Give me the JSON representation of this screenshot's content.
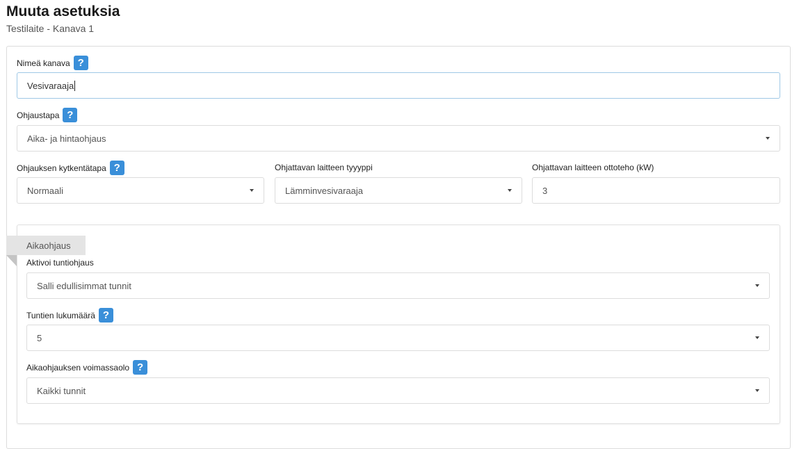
{
  "header": {
    "title": "Muuta asetuksia",
    "subtitle": "Testilaite - Kanava 1"
  },
  "help_glyph": "?",
  "fields": {
    "channel_name": {
      "label": "Nimeä kanava",
      "value": "Vesivaraaja"
    },
    "control_method": {
      "label": "Ohjaustapa",
      "value": "Aika- ja hintaohjaus"
    },
    "switching_mode": {
      "label": "Ohjauksen kytkentätapa",
      "value": "Normaali"
    },
    "device_type": {
      "label": "Ohjattavan laitteen tyyyppi",
      "value": "Lämminvesivaraaja"
    },
    "device_power": {
      "label": "Ohjattavan laitteen ottoteho (kW)",
      "value": "3"
    }
  },
  "time_control": {
    "tab_label": "Aikaohjaus",
    "activate_hourly": {
      "label": "Aktivoi tuntiohjaus",
      "value": "Salli edullisimmat tunnit"
    },
    "hour_count": {
      "label": "Tuntien lukumäärä",
      "value": "5"
    },
    "validity": {
      "label": "Aikaohjauksen voimassaolo",
      "value": "Kaikki tunnit"
    }
  },
  "colors": {
    "help_button": "#3a8fd9",
    "focused_border": "#9fc8e6",
    "tab_background": "#e4e4e4"
  }
}
